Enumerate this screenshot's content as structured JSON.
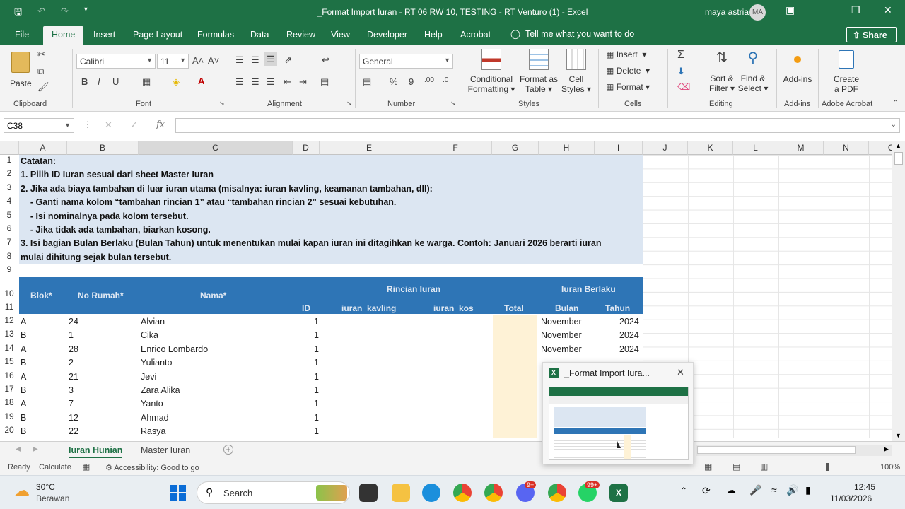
{
  "title_bar": {
    "title": "_Format Import Iuran - RT 06 RW 10, TESTING - RT Venturo (1)  -  Excel",
    "user_name": "maya astria",
    "user_initials": "MA"
  },
  "menu_tabs": [
    "File",
    "Home",
    "Insert",
    "Page Layout",
    "Formulas",
    "Data",
    "Review",
    "View",
    "Developer",
    "Help",
    "Acrobat"
  ],
  "tell_me": "Tell me what you want to do",
  "share_label": "Share",
  "ribbon": {
    "clipboard": {
      "paste": "Paste",
      "label": "Clipboard"
    },
    "font": {
      "name": "Calibri",
      "size": "11",
      "label": "Font"
    },
    "alignment": {
      "label": "Alignment"
    },
    "number": {
      "format": "General",
      "label": "Number"
    },
    "styles": {
      "conditional": [
        "Conditional",
        "Formatting"
      ],
      "format_table": [
        "Format as",
        "Table"
      ],
      "cell_styles": [
        "Cell",
        "Styles"
      ],
      "label": "Styles"
    },
    "cells": {
      "insert": "Insert",
      "delete": "Delete",
      "format": "Format",
      "label": "Cells"
    },
    "editing": {
      "sort": [
        "Sort &",
        "Filter"
      ],
      "find": [
        "Find &",
        "Select"
      ],
      "label": "Editing"
    },
    "addins": {
      "btn": "Add-ins",
      "label": "Add-ins"
    },
    "acrobat": {
      "btn": [
        "Create",
        "a PDF"
      ],
      "label": "Adobe Acrobat"
    }
  },
  "name_box": "C38",
  "columns": [
    "A",
    "B",
    "C",
    "D",
    "E",
    "F",
    "G",
    "H",
    "I",
    "J",
    "K",
    "L",
    "M",
    "N",
    "O"
  ],
  "rows": [
    "1",
    "2",
    "3",
    "4",
    "5",
    "6",
    "7",
    "8",
    "9",
    "10",
    "11",
    "12",
    "13",
    "14",
    "15",
    "16",
    "17",
    "18",
    "19",
    "20"
  ],
  "notes": [
    "Catatan:",
    "1. Pilih ID Iuran sesuai dari sheet Master Iuran",
    "2. Jika ada biaya tambahan di luar iuran utama (misalnya: iuran kavling, keamanan tambahan, dll):",
    "    - Ganti nama kolom “tambahan rincian 1” atau “tambahan rincian 2” sesuai kebutuhan.",
    "    - Isi nominalnya pada kolom tersebut.",
    "    - Jika tidak ada tambahan, biarkan kosong.",
    "3. Isi bagian Bulan Berlaku (Bulan Tahun) untuk menentukan mulai kapan iuran ini ditagihkan ke warga. Contoh: Januari 2026 berarti iuran",
    "mulai dihitung sejak bulan tersebut."
  ],
  "table_header": {
    "blok": "Blok*",
    "no_rumah": "No Rumah*",
    "nama": "Nama*",
    "rincian": "Rincian Iuran",
    "berlaku": "Iuran Berlaku",
    "id": "ID",
    "kavling": "iuran_kavling",
    "kos": "iuran_kos",
    "total": "Total",
    "bulan": "Bulan",
    "tahun": "Tahun"
  },
  "table_rows": [
    {
      "blok": "A",
      "no": "24",
      "nama": "Alvian",
      "id": "1",
      "bulan": "November",
      "tahun": "2024"
    },
    {
      "blok": "B",
      "no": "1",
      "nama": "Cika",
      "id": "1",
      "bulan": "November",
      "tahun": "2024"
    },
    {
      "blok": "A",
      "no": "28",
      "nama": "Enrico Lombardo",
      "id": "1",
      "bulan": "November",
      "tahun": "2024"
    },
    {
      "blok": "B",
      "no": "2",
      "nama": "Yulianto",
      "id": "1",
      "bulan": "",
      "tahun": ""
    },
    {
      "blok": "A",
      "no": "21",
      "nama": "Jevi",
      "id": "1",
      "bulan": "",
      "tahun": ""
    },
    {
      "blok": "B",
      "no": "3",
      "nama": "Zara Alika",
      "id": "1",
      "bulan": "",
      "tahun": ""
    },
    {
      "blok": "A",
      "no": "7",
      "nama": "Yanto",
      "id": "1",
      "bulan": "",
      "tahun": ""
    },
    {
      "blok": "B",
      "no": "12",
      "nama": "Ahmad",
      "id": "1",
      "bulan": "",
      "tahun": ""
    },
    {
      "blok": "B",
      "no": "22",
      "nama": "Rasya",
      "id": "1",
      "bulan": "",
      "tahun": ""
    }
  ],
  "sheet_tabs": [
    "Iuran Hunian",
    "Master Iuran"
  ],
  "status": {
    "ready": "Ready",
    "calculate": "Calculate",
    "accessibility": "Accessibility: Good to go",
    "zoom": "100%"
  },
  "popup": {
    "title": "_Format Import Iura..."
  },
  "taskbar": {
    "weather_temp": "30°C",
    "weather_desc": "Berawan",
    "search": "Search",
    "time": "12:45",
    "date": "11/03/2026",
    "whatsapp_badge": "99+",
    "discord_badge": "9+"
  },
  "colors": {
    "excel_green": "#1e7145",
    "header_blue": "#2e75b6",
    "notes_bg": "#dce6f2",
    "total_bg": "#fef2d6"
  }
}
